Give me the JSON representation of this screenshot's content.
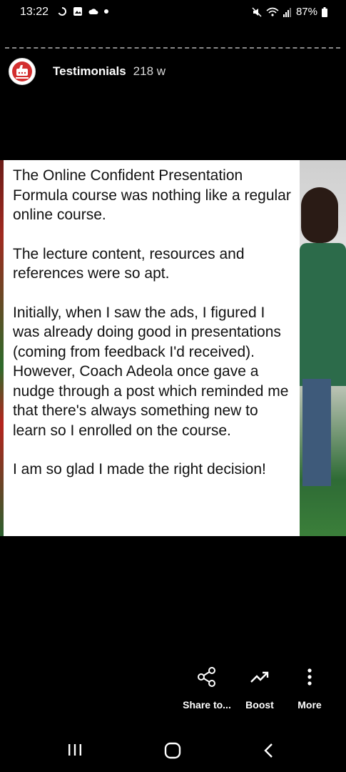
{
  "status_bar": {
    "time": "13:22",
    "battery": "87%"
  },
  "story": {
    "progress": 0.0
  },
  "header": {
    "page_name": "Testimonials",
    "post_age": "218 w"
  },
  "testimonial": {
    "paragraphs": [
      "The Online Confident Presentation Formula course was nothing like a regular online course.",
      "The lecture content, resources and references were so apt.",
      "Initially, when I saw the ads, I figured I was already doing good in presentations (coming from feedback I'd received). However, Coach Adeola once gave a nudge through a post which reminded me that there's always something new to learn so I enrolled on the course.",
      "I am so glad I made the right decision!"
    ]
  },
  "actions": {
    "share_label": "Share to...",
    "boost_label": "Boost",
    "more_label": "More"
  },
  "colors": {
    "background": "#000000",
    "card": "#ffffff",
    "avatar_red": "#d32f2f"
  },
  "icons": {
    "share": "share-icon",
    "boost": "boost-trend-icon",
    "more": "more-vertical-icon",
    "nav_recents": "recents-icon",
    "nav_home": "home-icon",
    "nav_back": "back-icon"
  }
}
